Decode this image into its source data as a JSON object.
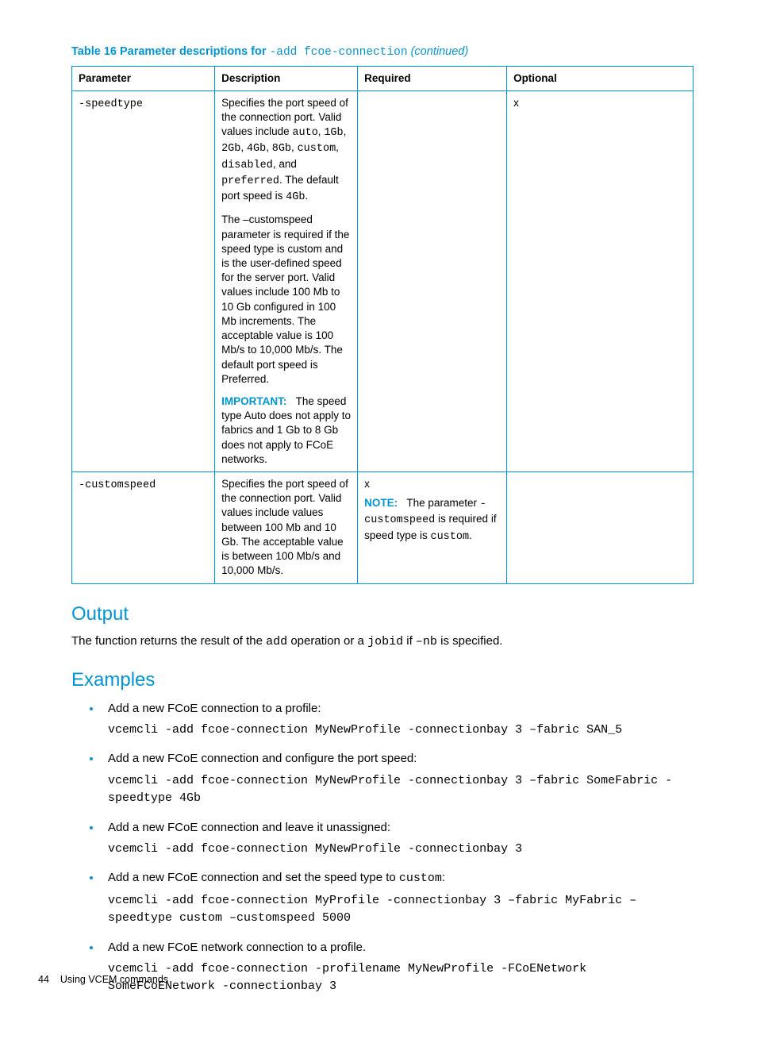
{
  "caption": {
    "prefix": "Table 16 Parameter descriptions for ",
    "code": "-add fcoe-connection",
    "suffix": " (continued)"
  },
  "headers": {
    "c0": "Parameter",
    "c1": "Description",
    "c2": "Required",
    "c3": "Optional"
  },
  "row1": {
    "param": "-speedtype",
    "d1a": "Specifies the port speed of the connection port. Valid values include ",
    "d1b": "auto",
    "d1c": ", ",
    "d1d": "1Gb",
    "d1e": ", ",
    "d1f": "2Gb",
    "d1g": ", ",
    "d1h": "4Gb",
    "d1i": ", ",
    "d1j": "8Gb",
    "d1k": ", ",
    "d1l": "custom",
    "d1m": ", ",
    "d1n": "disabled",
    "d1o": ", and ",
    "d1p": "preferred",
    "d1q": ". The default port speed is ",
    "d1r": "4Gb",
    "d1s": ".",
    "d2": "The –customspeed parameter is required if the speed type is custom and is the user-defined speed for the server port. Valid values include 100 Mb to 10 Gb configured in 100 Mb increments. The acceptable value is 100 Mb/s to 10,000 Mb/s. The default port speed is Preferred.",
    "d3label": "IMPORTANT:",
    "d3": "The speed type Auto does not apply to fabrics and 1 Gb to 8 Gb does not apply to FCoE networks.",
    "optional": "x"
  },
  "row2": {
    "param": "-customspeed",
    "desc": "Specifies the port speed of the connection port. Valid values include values between 100 Mb and 10 Gb. The acceptable value is between 100 Mb/s and 10,000 Mb/s.",
    "req_x": "x",
    "note_label": "NOTE:",
    "note_a": "The parameter ",
    "note_b": "-customspeed",
    "note_c": " is required if speed type is ",
    "note_d": "custom",
    "note_e": "."
  },
  "output": {
    "heading": "Output",
    "t1": "The function returns the result of the ",
    "t2": "add",
    "t3": " operation or a ",
    "t4": "jobid",
    "t5": " if ",
    "t6": "–nb",
    "t7": " is specified."
  },
  "examples": {
    "heading": "Examples",
    "items": [
      {
        "text_a": "Add a new FCoE connection to a profile:",
        "cmd": "vcemcli -add fcoe-connection MyNewProfile -connectionbay 3 –fabric SAN_5"
      },
      {
        "text_a": "Add a new FCoE connection and configure the port speed:",
        "cmd": "vcemcli -add fcoe-connection MyNewProfile -connectionbay 3 –fabric SomeFabric -speedtype 4Gb"
      },
      {
        "text_a": "Add a new FCoE connection and leave it unassigned:",
        "cmd": "vcemcli -add fcoe-connection MyNewProfile -connectionbay 3"
      },
      {
        "text_a": "Add a new FCoE connection and set the speed type to ",
        "text_code": "custom",
        "text_b": ":",
        "cmd": "vcemcli -add fcoe-connection MyProfile -connectionbay 3 –fabric MyFabric –speedtype custom –customspeed 5000"
      },
      {
        "text_a": "Add a new FCoE network connection to a profile.",
        "cmd": "vcemcli -add fcoe-connection -profilename MyNewProfile -FCoENetwork SomeFCoENetwork -connectionbay 3"
      }
    ]
  },
  "footer": {
    "page": "44",
    "section": "Using VCEM commands"
  }
}
